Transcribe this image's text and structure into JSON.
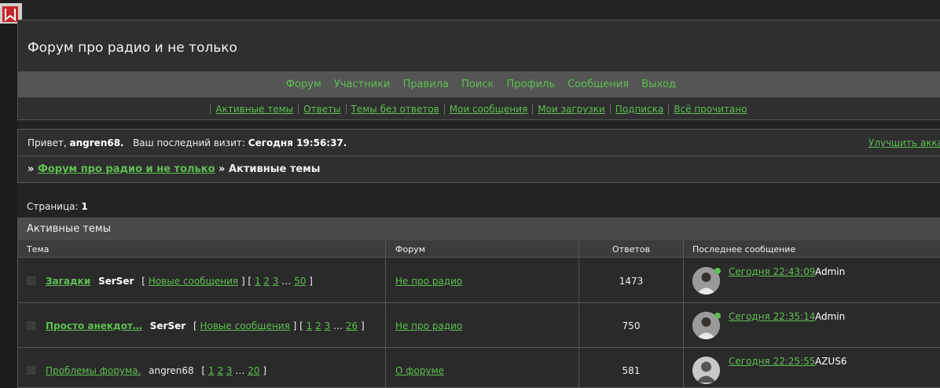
{
  "header": {
    "title": "Форум про радио и не только",
    "nav": [
      "Форум",
      "Участники",
      "Правила",
      "Поиск",
      "Профиль",
      "Сообщения",
      "Выход"
    ],
    "subnav": [
      "Активные темы",
      "Ответы",
      "Темы без ответов",
      "Мои сообщения",
      "Мои загрузки",
      "Подписка",
      "Всё прочитано"
    ]
  },
  "info": {
    "greet_prefix": "Привет,",
    "username": "angren68.",
    "last_visit_label": "Ваш последний визит:",
    "last_visit_value": "Сегодня 19:56:37.",
    "upgrade_link": "Улучшить аккаунт",
    "crumb_sep": "»",
    "crumb_forum": "Форум про радио и не только",
    "crumb_current": "Активные темы"
  },
  "pagination": {
    "label": "Страница:",
    "current": "1"
  },
  "table": {
    "caption": "Активные темы",
    "columns": {
      "topic": "Тема",
      "forum": "Форум",
      "replies": "Ответов",
      "last": "Последнее сообщение"
    },
    "rows": [
      {
        "name": "Загадки",
        "author": "SerSer",
        "new_msgs": "Новые сообщения",
        "pages": [
          "1",
          "2",
          "3",
          "…",
          "50"
        ],
        "forum": "Не про радио",
        "replies": "1473",
        "last_date": "Сегодня 22:43:09",
        "last_user": "Admin"
      },
      {
        "name": "Просто анекдот…",
        "author": "SerSer",
        "new_msgs": "Новые сообщения",
        "pages": [
          "1",
          "2",
          "3",
          "…",
          "26"
        ],
        "forum": "Не про радио",
        "replies": "750",
        "last_date": "Сегодня 22:35:14",
        "last_user": "Admin"
      },
      {
        "name": "Проблемы форума.",
        "author": "angren68",
        "pages": [
          "1",
          "2",
          "3",
          "…",
          "20"
        ],
        "forum": "О форуме",
        "replies": "581",
        "last_date": "Сегодня 22:25:55",
        "last_user": "AZUS6"
      }
    ]
  },
  "colors": {
    "link": "#5cbf4f",
    "background": "#232323",
    "panel": "#2f2f2f",
    "navbar": "#555555"
  }
}
